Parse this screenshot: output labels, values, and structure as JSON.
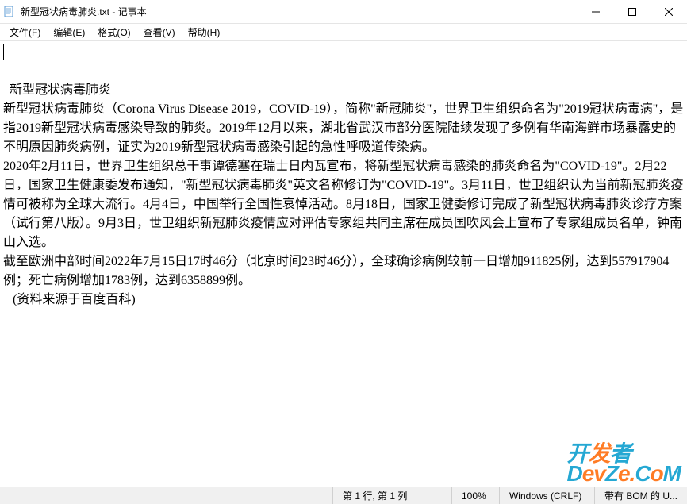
{
  "window": {
    "title": "新型冠状病毒肺炎.txt - 记事本"
  },
  "menu": {
    "file": "文件(F)",
    "edit": "编辑(E)",
    "format": "格式(O)",
    "view": "查看(V)",
    "help": "帮助(H)"
  },
  "content": {
    "text": "新型冠状病毒肺炎\n新型冠状病毒肺炎（Corona Virus Disease 2019，COVID-19），简称\"新冠肺炎\"，世界卫生组织命名为\"2019冠状病毒病\"，是指2019新型冠状病毒感染导致的肺炎。2019年12月以来，湖北省武汉市部分医院陆续发现了多例有华南海鲜市场暴露史的不明原因肺炎病例，证实为2019新型冠状病毒感染引起的急性呼吸道传染病。\n2020年2月11日，世界卫生组织总干事谭德塞在瑞士日内瓦宣布，将新型冠状病毒感染的肺炎命名为\"COVID-19\"。2月22日，国家卫生健康委发布通知，\"新型冠状病毒肺炎\"英文名称修订为\"COVID-19\"。3月11日，世卫组织认为当前新冠肺炎疫情可被称为全球大流行。4月4日，中国举行全国性哀悼活动。8月18日，国家卫健委修订完成了新型冠状病毒肺炎诊疗方案（试行第八版）。9月3日，世卫组织新冠肺炎疫情应对评估专家组共同主席在成员国吹风会上宣布了专家组成员名单，钟南山入选。\n截至欧洲中部时间2022年7月15日17时46分（北京时间23时46分），全球确诊病例较前一日增加911825例，达到557917904例；死亡病例增加1783例，达到6358899例。\n   (资料来源于百度百科)"
  },
  "statusbar": {
    "position": "第 1 行, 第 1 列",
    "zoom": "100%",
    "lineending": "Windows (CRLF)",
    "encoding": "带有 BOM 的 U..."
  },
  "watermark": {
    "line1_a": "开",
    "line1_b": "发",
    "line1_c": "者",
    "line2_a": "D",
    "line2_b": "ev",
    "line2_c": "Z",
    "line2_d": "e.",
    "line2_e": "C",
    "line2_f": "o",
    "line2_g": "M"
  }
}
